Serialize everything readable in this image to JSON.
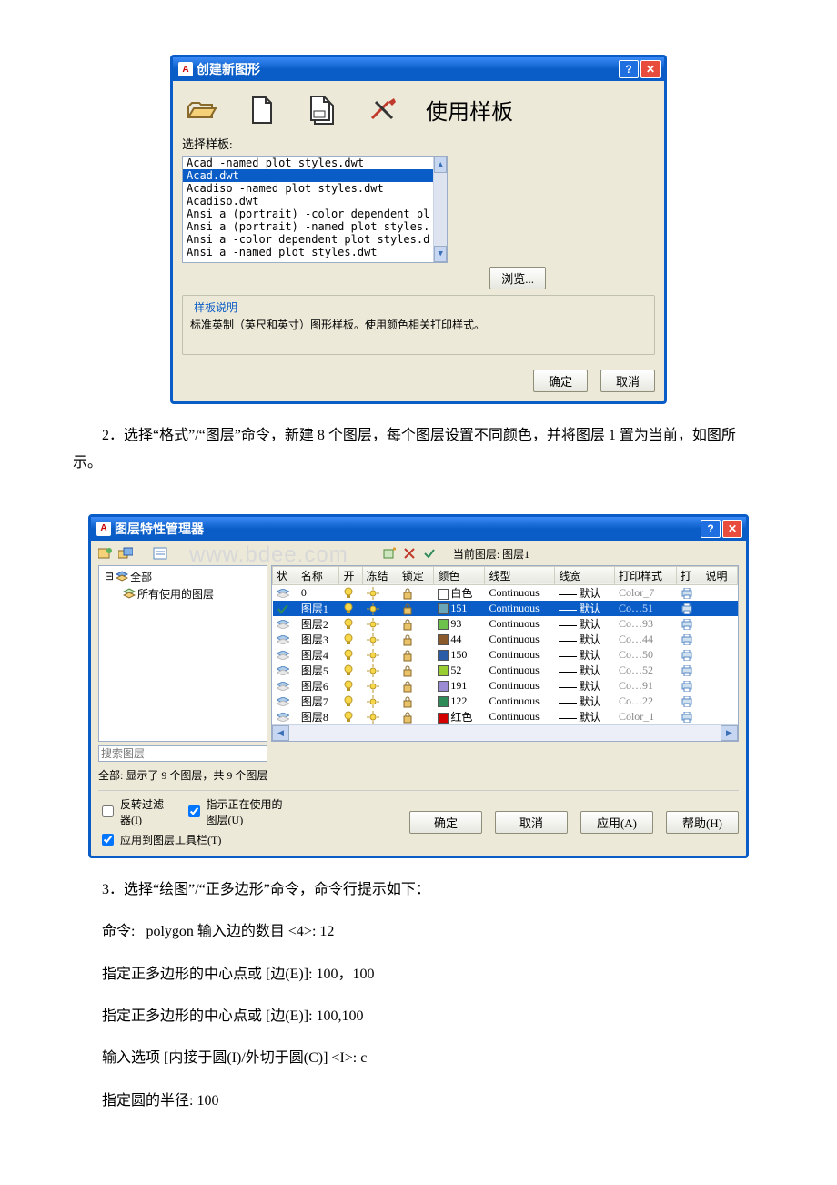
{
  "dialog1": {
    "title": "创建新图形",
    "use_template_heading": "使用样板",
    "select_label": "选择样板:",
    "list_items": [
      "Acad -named plot styles.dwt",
      "Acad.dwt",
      "Acadiso -named plot styles.dwt",
      "Acadiso.dwt",
      "Ansi a (portrait) -color dependent pl",
      "Ansi a (portrait) -named plot styles.",
      "Ansi a -color dependent plot styles.d",
      "Ansi a -named plot styles.dwt"
    ],
    "browse": "浏览...",
    "group_title": "样板说明",
    "group_desc": "标准英制（英尺和英寸）图形样板。使用颜色相关打印样式。",
    "ok": "确定",
    "cancel": "取消",
    "icons": {
      "open": "open-folder-icon",
      "blank": "blank-page-icon",
      "template": "page-template-icon",
      "wizard": "pencil-cross-icon"
    }
  },
  "paragraph_step2": "2．选择“格式”/“图层”命令，新建 8 个图层，每个图层设置不同颜色，并将图层 1 置为当前，如图所示。",
  "dialog2": {
    "title": "图层特性管理器",
    "current_label": "当前图层:",
    "current_layer": "图层1",
    "tree": {
      "root": "全部",
      "child": "所有使用的图层"
    },
    "headers": [
      "状",
      "名称",
      "开",
      "冻结",
      "锁定",
      "颜色",
      "线型",
      "线宽",
      "打印样式",
      "打",
      "说明"
    ],
    "rows": [
      {
        "name": "0",
        "color_name": "白色",
        "color": "#ffffff",
        "linetype": "Continuous",
        "lineweight": "默认",
        "plot": "Color_7"
      },
      {
        "name": "图层1",
        "color_name": "151",
        "color": "#6aa6b8",
        "linetype": "Continuous",
        "lineweight": "默认",
        "plot": "Co…51",
        "selected": true
      },
      {
        "name": "图层2",
        "color_name": "93",
        "color": "#6cc24a",
        "linetype": "Continuous",
        "lineweight": "默认",
        "plot": "Co…93"
      },
      {
        "name": "图层3",
        "color_name": "44",
        "color": "#8b5a2b",
        "linetype": "Continuous",
        "lineweight": "默认",
        "plot": "Co…44"
      },
      {
        "name": "图层4",
        "color_name": "150",
        "color": "#2b5ca8",
        "linetype": "Continuous",
        "lineweight": "默认",
        "plot": "Co…50"
      },
      {
        "name": "图层5",
        "color_name": "52",
        "color": "#9acd32",
        "linetype": "Continuous",
        "lineweight": "默认",
        "plot": "Co…52"
      },
      {
        "name": "图层6",
        "color_name": "191",
        "color": "#9b8bd4",
        "linetype": "Continuous",
        "lineweight": "默认",
        "plot": "Co…91"
      },
      {
        "name": "图层7",
        "color_name": "122",
        "color": "#2e8b57",
        "linetype": "Continuous",
        "lineweight": "默认",
        "plot": "Co…22"
      },
      {
        "name": "图层8",
        "color_name": "红色",
        "color": "#d40000",
        "linetype": "Continuous",
        "lineweight": "默认",
        "plot": "Color_1"
      }
    ],
    "search_placeholder": "搜索图层",
    "status": "全部: 显示了 9 个图层，共 9 个图层",
    "cb_invert": "反转过滤器(I)",
    "cb_indicate": "指示正在使用的图层(U)",
    "cb_apply_toolbar": "应用到图层工具栏(T)",
    "ok": "确定",
    "cancel": "取消",
    "apply": "应用(A)",
    "help": "帮助(H)",
    "watermark": "www.bdee.com"
  },
  "steps": {
    "s3": "3．选择“绘图”/“正多边形”命令，命令行提示如下：",
    "c1": "命令: _polygon 输入边的数目 <4>: 12",
    "c2": "指定正多边形的中心点或 [边(E)]: 100，100",
    "c3": "指定正多边形的中心点或 [边(E)]: 100,100",
    "c4": "输入选项 [内接于圆(I)/外切于圆(C)] <I>: c",
    "c5": "指定圆的半径: 100"
  }
}
